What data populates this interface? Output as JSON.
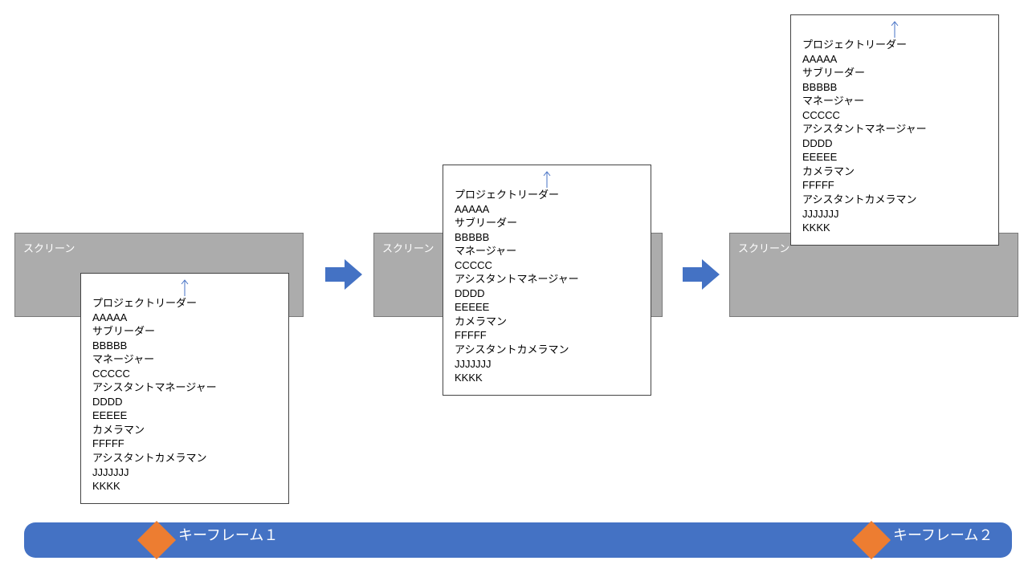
{
  "screen_label": "スクリーン",
  "credits": {
    "lines": [
      "プロジェクトリーダー",
      "AAAAA",
      "サブリーダー",
      "BBBBB",
      "マネージャー",
      "CCCCC",
      "アシスタントマネージャー",
      "DDDD",
      "EEEEE",
      "カメラマン",
      "FFFFF",
      "アシスタントカメラマン",
      "JJJJJJJ",
      "KKKK"
    ]
  },
  "keyframes": [
    {
      "label": "キーフレーム１"
    },
    {
      "label": "キーフレーム２"
    }
  ],
  "colors": {
    "screen_bg": "rgba(128,128,128,0.65)",
    "timeline_bg": "#4472c4",
    "arrow_blue": "#4472c4",
    "marker_orange": "#ed7d31",
    "arrow_line_blue": "#4571c4"
  }
}
